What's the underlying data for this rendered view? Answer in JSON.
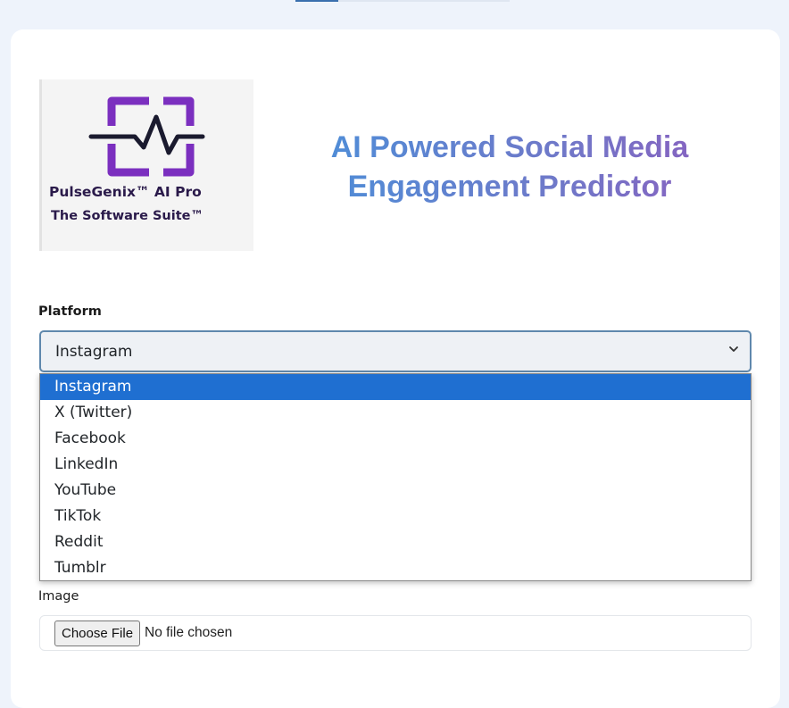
{
  "header": {
    "logo_line1": "PulseGenix™ AI Pro",
    "logo_line2": "The Software Suite™",
    "title": "AI Powered Social Media Engagement Predictor",
    "title_gradient": [
      "#4a90d9",
      "#8b5fbf"
    ]
  },
  "form": {
    "platform_label": "Platform",
    "platform_selected": "Instagram",
    "platform_options": [
      "Instagram",
      "X (Twitter)",
      "Facebook",
      "LinkedIn",
      "YouTube",
      "TikTok",
      "Reddit",
      "Tumblr"
    ],
    "image_label": "Image",
    "file_button": "Choose File",
    "file_status": "No file chosen"
  },
  "colors": {
    "accent": "#1f6fd1",
    "logo_purple": "#7b2fbf",
    "background": "#eef3fb"
  },
  "icons": {
    "select_chevron": "chevron-down-icon"
  }
}
